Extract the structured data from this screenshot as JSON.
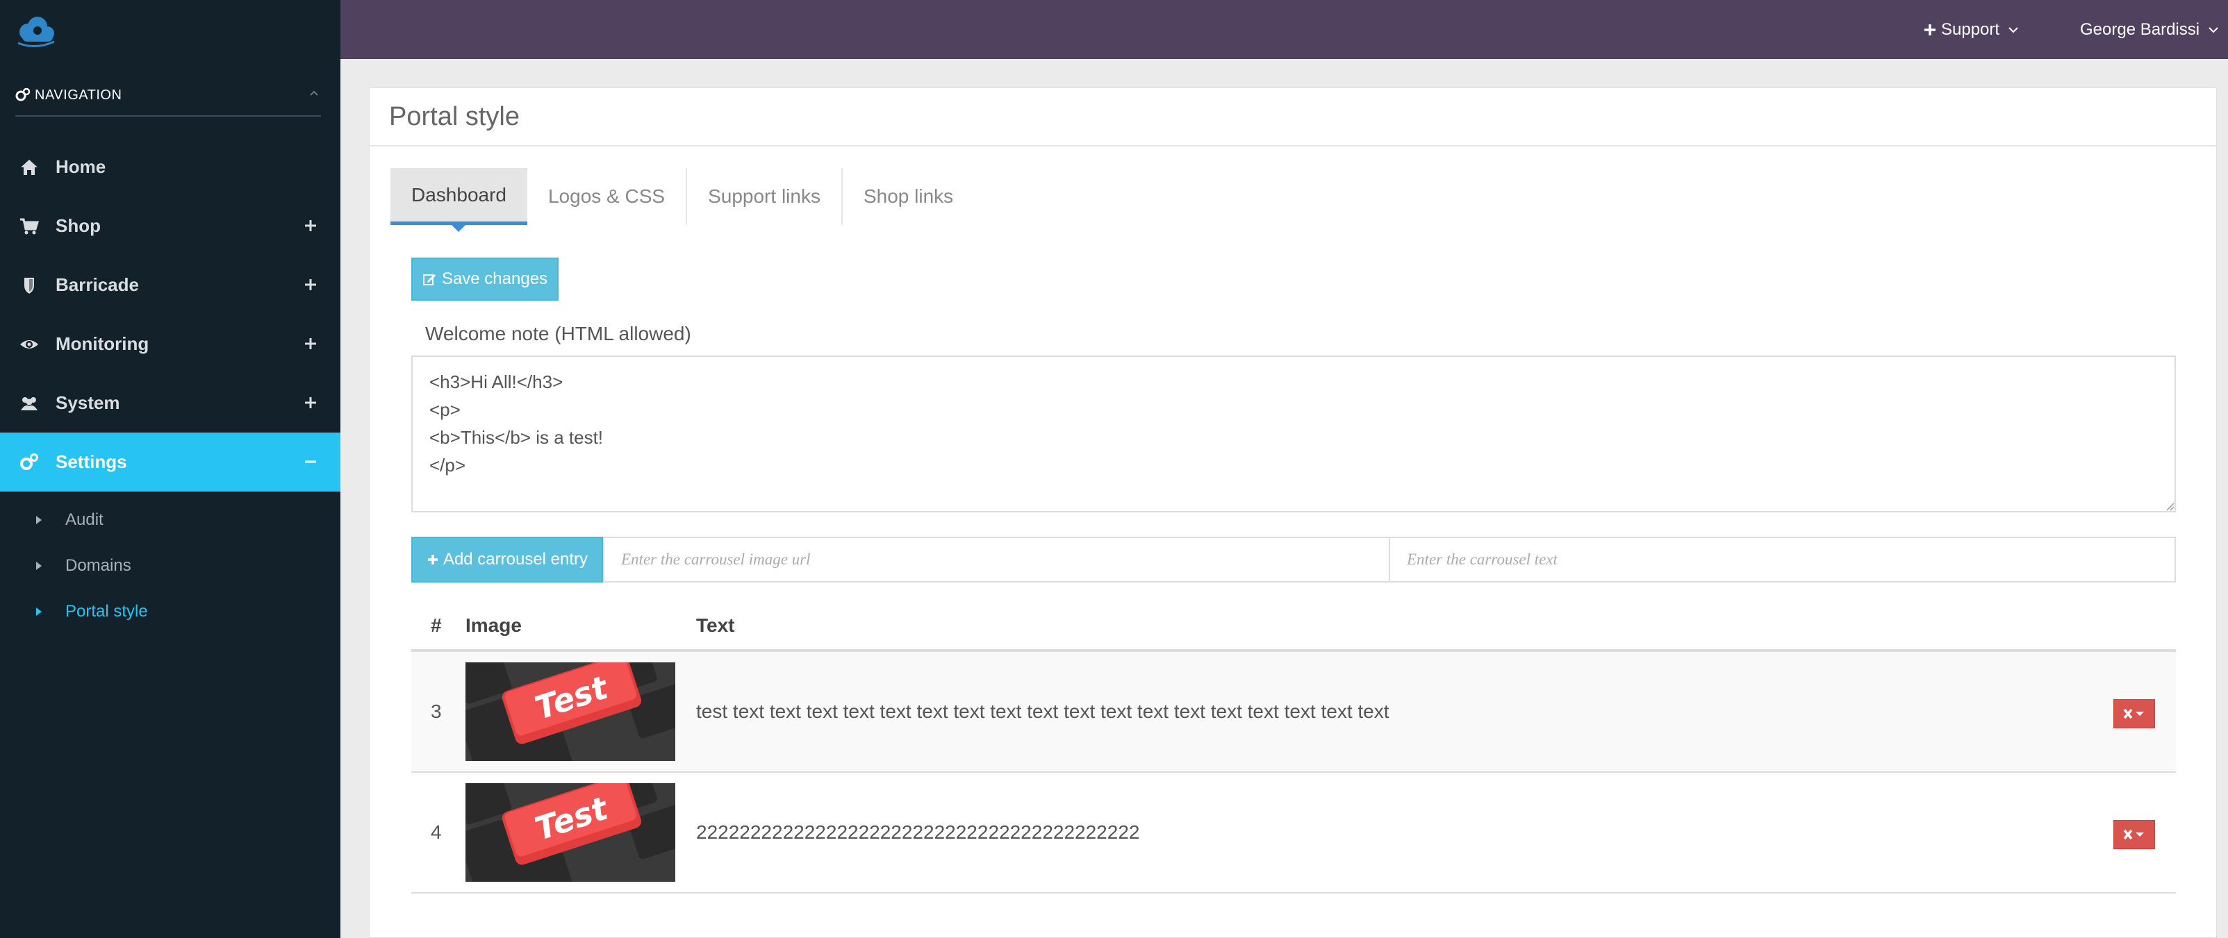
{
  "sidebar": {
    "nav_header": "NAVIGATION",
    "items": [
      {
        "label": "Home",
        "icon": "home-icon"
      },
      {
        "label": "Shop",
        "icon": "cart-icon"
      },
      {
        "label": "Barricade",
        "icon": "shield-icon"
      },
      {
        "label": "Monitoring",
        "icon": "eye-icon"
      },
      {
        "label": "System",
        "icon": "users-icon"
      },
      {
        "label": "Settings",
        "icon": "gears-icon",
        "active": true
      }
    ],
    "sub_items": [
      {
        "label": "Audit"
      },
      {
        "label": "Domains"
      },
      {
        "label": "Portal style",
        "active": true
      }
    ]
  },
  "topbar": {
    "support_label": "Support",
    "user_label": "George Bardissi"
  },
  "panel": {
    "title": "Portal style",
    "tabs": [
      "Dashboard",
      "Logos & CSS",
      "Support links",
      "Shop links"
    ],
    "save_label": "Save changes",
    "welcome_label": "Welcome note (HTML allowed)",
    "welcome_value": "<h3>Hi All!</h3>\n<p>\n<b>This</b> is a test!\n</p>",
    "add_label": "Add carrousel entry",
    "url_placeholder": "Enter the carrousel image url",
    "text_placeholder": "Enter the carrousel text",
    "table": {
      "headers": [
        "#",
        "Image",
        "Text"
      ],
      "rows": [
        {
          "num": "3",
          "text": "test text text text text text text text text text text text text text text text text text text",
          "image_text": "Test"
        },
        {
          "num": "4",
          "text": "22222222222222222222222222222222222222222",
          "image_text": "Test"
        }
      ]
    }
  },
  "colors": {
    "sidebar_bg": "#13212a",
    "topbar_bg": "#50425f",
    "accent": "#27c3f3",
    "info_button": "#5bc0de",
    "danger_button": "#d9534f",
    "tab_underline": "#3b8ed3"
  }
}
